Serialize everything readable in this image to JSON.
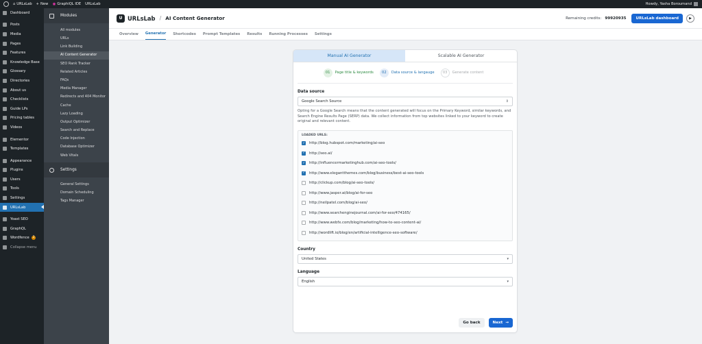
{
  "adminbar": {
    "site_name": "URLsLab",
    "new_label": "New",
    "graphiql_label": "GraphiQL IDE",
    "urlslab_label": "URLsLab",
    "howdy": "Howdy, Yasha Boroumand"
  },
  "admin_menu": [
    {
      "label": "Dashboard",
      "icon": "dashboard-icon"
    },
    {
      "label": "Posts",
      "icon": "pin-icon"
    },
    {
      "label": "Media",
      "icon": "media-icon"
    },
    {
      "label": "Pages",
      "icon": "page-icon"
    },
    {
      "label": "Features",
      "icon": "pin-icon"
    },
    {
      "label": "Knowledge Base",
      "icon": "book-icon"
    },
    {
      "label": "Glossary",
      "icon": "book-icon"
    },
    {
      "label": "Directories",
      "icon": "folder-icon"
    },
    {
      "label": "About us",
      "icon": "page-icon"
    },
    {
      "label": "Checklists",
      "icon": "list-icon"
    },
    {
      "label": "Guide LPs",
      "icon": "page-icon"
    },
    {
      "label": "Pricing tables",
      "icon": "table-icon"
    },
    {
      "label": "Videos",
      "icon": "video-icon"
    },
    {
      "label": "Elementor",
      "icon": "elementor-icon"
    },
    {
      "label": "Templates",
      "icon": "template-icon"
    },
    {
      "label": "Appearance",
      "icon": "brush-icon"
    },
    {
      "label": "Plugins",
      "icon": "plugin-icon"
    },
    {
      "label": "Users",
      "icon": "user-icon"
    },
    {
      "label": "Tools",
      "icon": "wrench-icon"
    },
    {
      "label": "Settings",
      "icon": "settings-icon"
    },
    {
      "label": "URLsLab",
      "icon": "urlslab-icon",
      "active": true
    },
    {
      "label": "Yoast SEO",
      "icon": "yoast-icon"
    },
    {
      "label": "GraphQL",
      "icon": "graphql-icon"
    },
    {
      "label": "Wordfence",
      "icon": "wordfence-icon",
      "badge": "2"
    },
    {
      "label": "Collapse menu",
      "icon": "collapse-icon"
    }
  ],
  "modules_sidebar": {
    "modules_title": "Modules",
    "modules": [
      "All modules",
      "URLs",
      "Link Building",
      "AI Content Generator",
      "SEO Rank Tracker",
      "Related Articles",
      "FAQs",
      "Media Manager",
      "Redirects and 404 Monitor",
      "Cache",
      "Lazy Loading",
      "Output Optimizer",
      "Search and Replace",
      "Code Injection",
      "Database Optimizer",
      "Web Vitals"
    ],
    "active_module": "AI Content Generator",
    "settings_title": "Settings",
    "settings": [
      "General Settings",
      "Domain Scheduling",
      "Tags Manager"
    ]
  },
  "header": {
    "brand": "URLsLab",
    "separator": "/",
    "title": "AI Content Generator",
    "credits_label": "Remaining credits:",
    "credits_value": "99920935",
    "dashboard_button": "URLsLab dashboard"
  },
  "tabs": [
    "Overview",
    "Generator",
    "Shortcodes",
    "Prompt Templates",
    "Results",
    "Running Processes",
    "Settings"
  ],
  "active_tab": "Generator",
  "card": {
    "mode_tabs": [
      "Manual AI Generator",
      "Scalable AI Generator"
    ],
    "steps": [
      {
        "num": "01",
        "label": "Page title & keywords",
        "state": "done"
      },
      {
        "num": "02",
        "label": "Data source & langauge",
        "state": "current"
      },
      {
        "num": "03",
        "label": "Generate content",
        "state": "todo"
      }
    ],
    "data_source_label": "Data source",
    "data_source_value": "Google Search Source",
    "help_text": "Opting for a Google Search means that the content generated will focus on the Primary Keyword, similar keywords, and Search Engine Results Page (SERP) data. We collect information from top websites linked to your keyword to create original and relevant content.",
    "loaded_urls_title": "LOADED URLS:",
    "urls": [
      {
        "url": "http://blog.hubspot.com/marketing/ai-seo",
        "checked": true
      },
      {
        "url": "http://seo.ai/",
        "checked": true
      },
      {
        "url": "http://influencermarketinghub.com/ai-seo-tools/",
        "checked": true
      },
      {
        "url": "http://www.elegantthemes.com/blog/business/best-ai-seo-tools",
        "checked": true
      },
      {
        "url": "http://clickup.com/blog/ai-seo-tools/",
        "checked": false
      },
      {
        "url": "http://www.jasper.ai/blog/ai-for-seo",
        "checked": false
      },
      {
        "url": "http://neilpatel.com/blog/ai-seo/",
        "checked": false
      },
      {
        "url": "http://www.searchenginejournal.com/ai-for-seo/474165/",
        "checked": false
      },
      {
        "url": "http://www.webfx.com/blog/marketing/how-to-seo-content-ai/",
        "checked": false
      },
      {
        "url": "http://wordlift.io/blog/en/artificial-intelligence-seo-software/",
        "checked": false
      }
    ],
    "country_label": "Country",
    "country_value": "United States",
    "language_label": "Language",
    "language_value": "English",
    "back_button": "Go back",
    "next_button": "Next"
  },
  "colors": {
    "primary": "#1967d2",
    "admin_dark": "#1d2327",
    "active_menu": "#2271b1",
    "step_done": "#2e8b42"
  }
}
